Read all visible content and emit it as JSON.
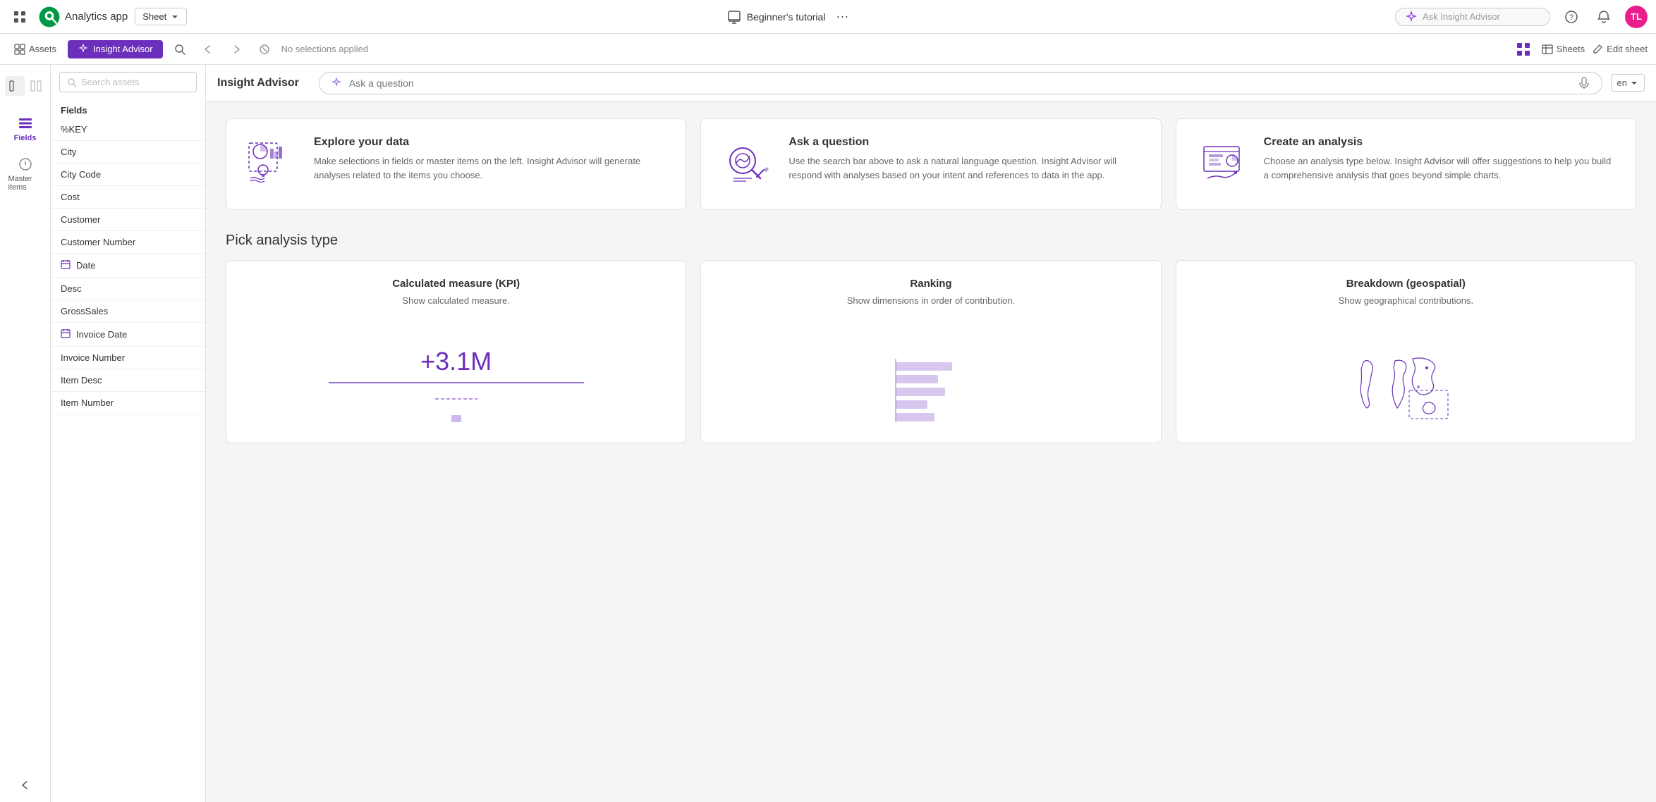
{
  "app": {
    "title": "Analytics app",
    "sheet_dropdown": "Sheet",
    "center_title": "Beginner's tutorial",
    "ai_placeholder": "Ask Insight Advisor",
    "lang": "en"
  },
  "toolbar": {
    "assets_label": "Assets",
    "insight_label": "Insight Advisor",
    "no_selections": "No selections applied",
    "sheets_label": "Sheets",
    "edit_sheet_label": "Edit sheet"
  },
  "sidebar": {
    "fields_label": "Fields",
    "master_items_label": "Master items"
  },
  "fields_panel": {
    "title": "Insight Advisor",
    "search_placeholder": "Search assets",
    "section_label": "Fields",
    "items": [
      {
        "name": "%KEY",
        "type": "text",
        "icon": ""
      },
      {
        "name": "City",
        "type": "text",
        "icon": ""
      },
      {
        "name": "City Code",
        "type": "text",
        "icon": ""
      },
      {
        "name": "Cost",
        "type": "text",
        "icon": ""
      },
      {
        "name": "Customer",
        "type": "text",
        "icon": ""
      },
      {
        "name": "Customer Number",
        "type": "text",
        "icon": ""
      },
      {
        "name": "Date",
        "type": "calendar",
        "icon": "📅"
      },
      {
        "name": "Desc",
        "type": "text",
        "icon": ""
      },
      {
        "name": "GrossSales",
        "type": "text",
        "icon": ""
      },
      {
        "name": "Invoice Date",
        "type": "calendar",
        "icon": "📅"
      },
      {
        "name": "Invoice Number",
        "type": "text",
        "icon": ""
      },
      {
        "name": "Item Desc",
        "type": "text",
        "icon": ""
      },
      {
        "name": "Item Number",
        "type": "text",
        "icon": ""
      }
    ]
  },
  "ia_header": {
    "title": "Insight Advisor",
    "ask_placeholder": "Ask a question",
    "lang": "en"
  },
  "cards": [
    {
      "title": "Explore your data",
      "description": "Make selections in fields or master items on the left. Insight Advisor will generate analyses related to the items you choose."
    },
    {
      "title": "Ask a question",
      "description": "Use the search bar above to ask a natural language question. Insight Advisor will respond with analyses based on your intent and references to data in the app."
    },
    {
      "title": "Create an analysis",
      "description": "Choose an analysis type below. Insight Advisor will offer suggestions to help you build a comprehensive analysis that goes beyond simple charts."
    }
  ],
  "analysis": {
    "section_title": "Pick analysis type",
    "types": [
      {
        "title": "Calculated measure (KPI)",
        "description": "Show calculated measure.",
        "visual_type": "kpi",
        "kpi_value": "+3.1M"
      },
      {
        "title": "Ranking",
        "description": "Show dimensions in order of contribution.",
        "visual_type": "bar"
      },
      {
        "title": "Breakdown (geospatial)",
        "description": "Show geographical contributions.",
        "visual_type": "geo"
      }
    ]
  }
}
